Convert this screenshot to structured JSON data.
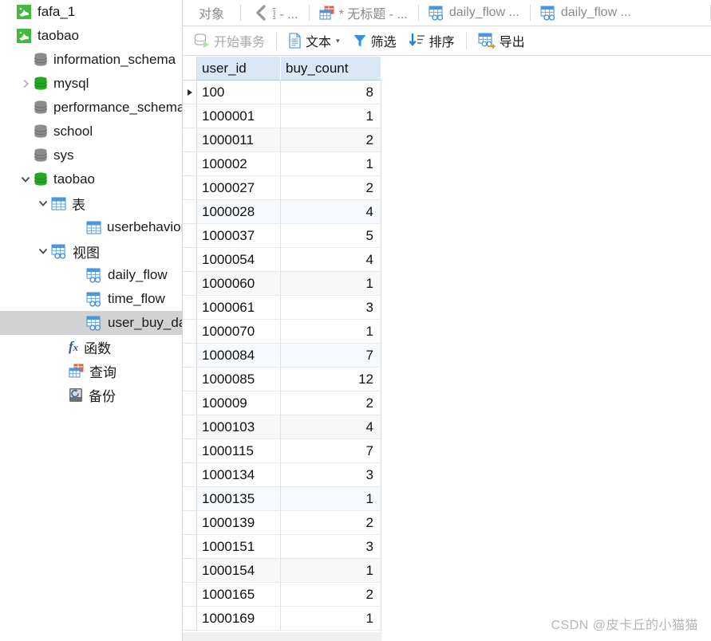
{
  "sidebar": {
    "items": [
      {
        "label": "fafa_1",
        "icon": "mysql-connection-icon",
        "indent": 0,
        "twisty": "",
        "selected": false,
        "icon_type": "conn"
      },
      {
        "label": "taobao",
        "icon": "mysql-connection-icon",
        "indent": 0,
        "twisty": "",
        "selected": false,
        "icon_type": "conn"
      },
      {
        "label": "information_schema",
        "icon": "database-icon",
        "indent": 22,
        "twisty": "",
        "selected": false,
        "icon_type": "db-gray"
      },
      {
        "label": "mysql",
        "icon": "database-icon",
        "indent": 22,
        "twisty": "right",
        "selected": false,
        "icon_type": "db-green"
      },
      {
        "label": "performance_schema",
        "icon": "database-icon",
        "indent": 22,
        "twisty": "",
        "selected": false,
        "icon_type": "db-gray"
      },
      {
        "label": "school",
        "icon": "database-icon",
        "indent": 22,
        "twisty": "",
        "selected": false,
        "icon_type": "db-gray"
      },
      {
        "label": "sys",
        "icon": "database-icon",
        "indent": 22,
        "twisty": "",
        "selected": false,
        "icon_type": "db-gray"
      },
      {
        "label": "taobao",
        "icon": "database-icon",
        "indent": 22,
        "twisty": "down",
        "selected": false,
        "icon_type": "db-green"
      },
      {
        "label": "表",
        "icon": "table-folder-icon",
        "indent": 44,
        "twisty": "down",
        "selected": false,
        "icon_type": "table"
      },
      {
        "label": "userbehavior",
        "icon": "table-icon",
        "indent": 88,
        "twisty": "",
        "selected": false,
        "icon_type": "table"
      },
      {
        "label": "视图",
        "icon": "view-folder-icon",
        "indent": 44,
        "twisty": "down",
        "selected": false,
        "icon_type": "view"
      },
      {
        "label": "daily_flow",
        "icon": "view-icon",
        "indent": 88,
        "twisty": "",
        "selected": false,
        "icon_type": "view"
      },
      {
        "label": "time_flow",
        "icon": "view-icon",
        "indent": 88,
        "twisty": "",
        "selected": false,
        "icon_type": "view"
      },
      {
        "label": "user_buy_data",
        "icon": "view-icon",
        "indent": 88,
        "twisty": "",
        "selected": true,
        "icon_type": "view"
      },
      {
        "label": "函数",
        "icon": "function-icon",
        "indent": 66,
        "twisty": "",
        "selected": false,
        "icon_type": "fx"
      },
      {
        "label": "查询",
        "icon": "query-icon",
        "indent": 66,
        "twisty": "",
        "selected": false,
        "icon_type": "query"
      },
      {
        "label": "备份",
        "icon": "backup-icon",
        "indent": 66,
        "twisty": "",
        "selected": false,
        "icon_type": "backup"
      }
    ]
  },
  "tabstrip": {
    "tabs": [
      {
        "label": "对象",
        "icon": "",
        "kind": "object"
      },
      {
        "label": "标题 - ...",
        "icon": "",
        "kind": "clipped"
      },
      {
        "label": "* 无标题 - ...",
        "icon": "query-icon",
        "kind": "query"
      },
      {
        "label": "daily_flow ...",
        "icon": "view-icon",
        "kind": "view"
      },
      {
        "label": "daily_flow ...",
        "icon": "view-icon",
        "kind": "view"
      }
    ],
    "scroll_left_icon": "chevron-left-icon"
  },
  "toolbar": {
    "buttons": [
      {
        "label": "开始事务",
        "icon": "begin-transaction-icon",
        "disabled": true,
        "caret": false
      },
      {
        "label": "文本",
        "icon": "text-icon",
        "disabled": false,
        "caret": true
      },
      {
        "label": "筛选",
        "icon": "filter-icon",
        "disabled": false,
        "caret": false
      },
      {
        "label": "排序",
        "icon": "sort-icon",
        "disabled": false,
        "caret": false
      },
      {
        "label": "导出",
        "icon": "export-icon",
        "disabled": false,
        "caret": false
      }
    ]
  },
  "grid": {
    "columns": [
      "user_id",
      "buy_count"
    ],
    "rows": [
      {
        "user_id": "100",
        "buy_count": "8",
        "current": true
      },
      {
        "user_id": "1000001",
        "buy_count": "1",
        "current": false
      },
      {
        "user_id": "1000011",
        "buy_count": "2",
        "current": false
      },
      {
        "user_id": "100002",
        "buy_count": "1",
        "current": false
      },
      {
        "user_id": "1000027",
        "buy_count": "2",
        "current": false
      },
      {
        "user_id": "1000028",
        "buy_count": "4",
        "current": false
      },
      {
        "user_id": "1000037",
        "buy_count": "5",
        "current": false
      },
      {
        "user_id": "1000054",
        "buy_count": "4",
        "current": false
      },
      {
        "user_id": "1000060",
        "buy_count": "1",
        "current": false
      },
      {
        "user_id": "1000061",
        "buy_count": "3",
        "current": false
      },
      {
        "user_id": "1000070",
        "buy_count": "1",
        "current": false
      },
      {
        "user_id": "1000084",
        "buy_count": "7",
        "current": false
      },
      {
        "user_id": "1000085",
        "buy_count": "12",
        "current": false
      },
      {
        "user_id": "100009",
        "buy_count": "2",
        "current": false
      },
      {
        "user_id": "1000103",
        "buy_count": "4",
        "current": false
      },
      {
        "user_id": "1000115",
        "buy_count": "7",
        "current": false
      },
      {
        "user_id": "1000134",
        "buy_count": "3",
        "current": false
      },
      {
        "user_id": "1000135",
        "buy_count": "1",
        "current": false
      },
      {
        "user_id": "1000139",
        "buy_count": "2",
        "current": false
      },
      {
        "user_id": "1000151",
        "buy_count": "3",
        "current": false
      },
      {
        "user_id": "1000154",
        "buy_count": "1",
        "current": false
      },
      {
        "user_id": "1000165",
        "buy_count": "2",
        "current": false
      },
      {
        "user_id": "1000169",
        "buy_count": "1",
        "current": false
      }
    ]
  },
  "watermark": {
    "text": "CSDN @皮卡丘的小猫猫"
  },
  "colors": {
    "header_bg": "#d9e7f7",
    "selection_bg": "#d2d2d2",
    "accent_blue": "#3a8dde",
    "db_green": "#22aa22",
    "db_gray": "#8c8c8c",
    "watermark": "#b6b6b6"
  }
}
